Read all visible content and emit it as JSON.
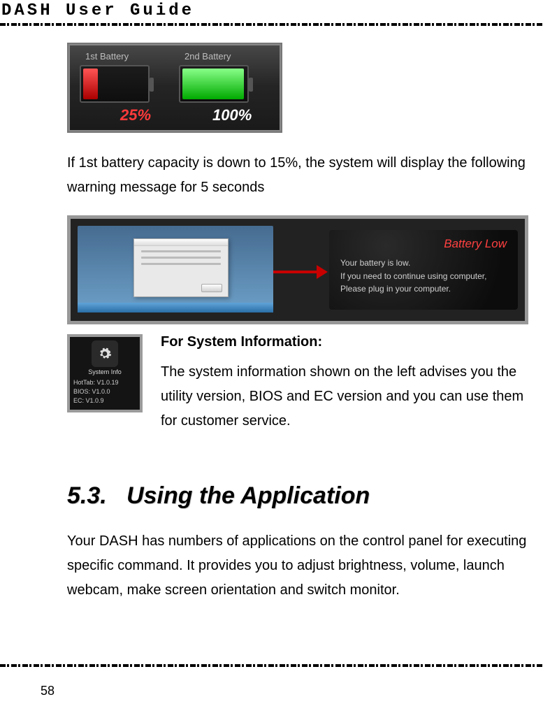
{
  "header": {
    "title": "DASH  User  Guide"
  },
  "fig1": {
    "label1": "1st Battery",
    "label2": "2nd Battery",
    "pct1": "25%",
    "pct2": "100%"
  },
  "para1": "If 1st battery capacity is down to 15%, the system will display the following warning message for 5 seconds",
  "fig2": {
    "popup_title": "Battery Low",
    "line1": "Your battery is low.",
    "line2": "If you need to continue using computer,",
    "line3": "Please plug in your computer."
  },
  "sysinfo": {
    "icon_label": "System Info",
    "l1": "HotTab: V1.0.19",
    "l2": "BIOS:    V1.0.0",
    "l3": "EC:       V1.0.9",
    "heading": "For System Information:",
    "desc": "The system information shown on the left advises you the utility version, BIOS and EC version and you can use them for customer service."
  },
  "section": {
    "num": "5.3.",
    "title": "Using the Application"
  },
  "para2": "Your DASH has numbers of applications on the control panel for executing specific command. It provides you to adjust brightness, volume, launch webcam, make screen orientation and switch monitor.",
  "page_number": "58"
}
